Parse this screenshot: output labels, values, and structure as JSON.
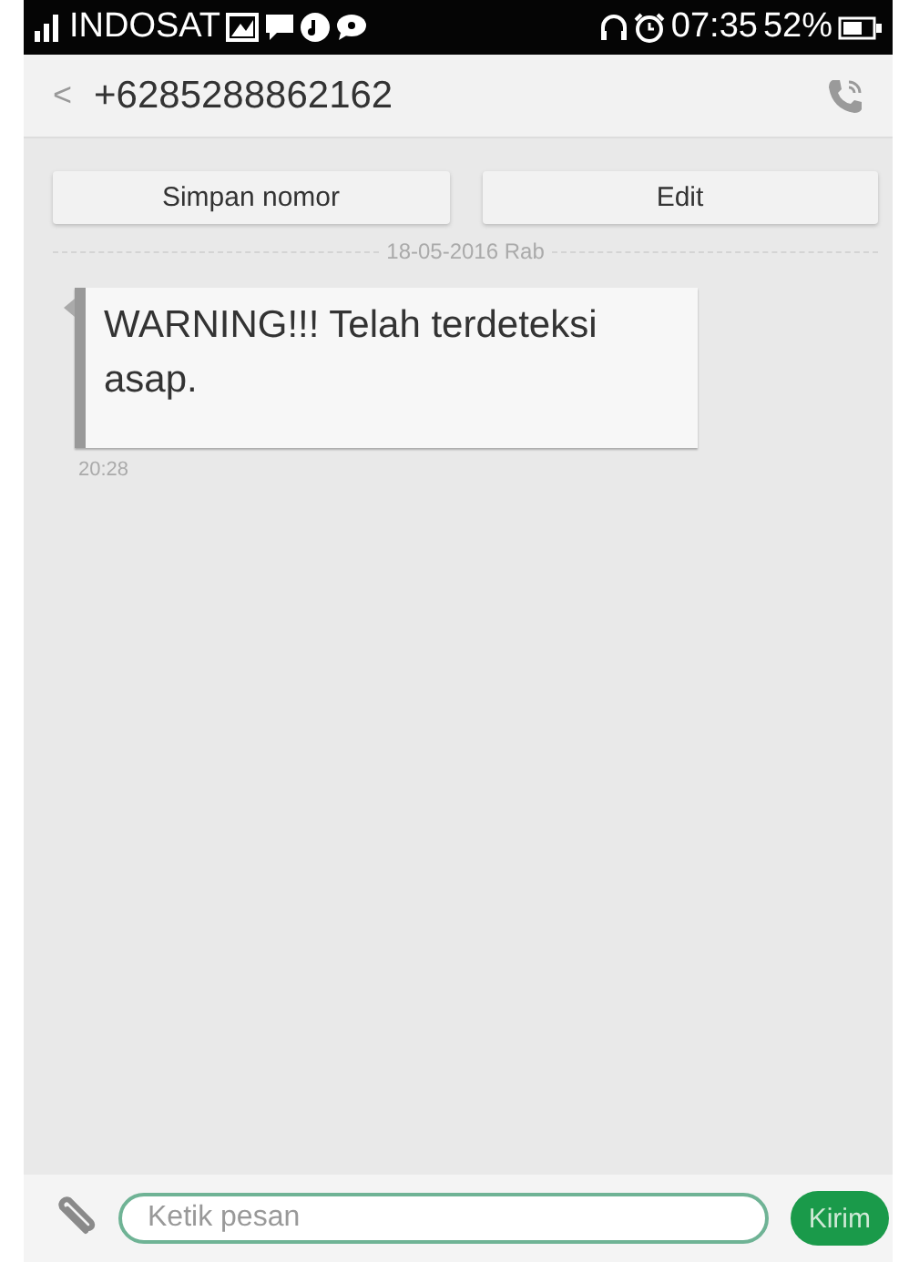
{
  "status_bar": {
    "carrier": "INDOSAT",
    "time": "07:35",
    "battery": "52%"
  },
  "header": {
    "back": "<",
    "title": "+6285288862162"
  },
  "actions": [
    "Simpan nomor",
    "Edit"
  ],
  "date_separator": "18-05-2016 Rab",
  "messages": [
    {
      "text": "WARNING!!! Telah terdeteksi asap.",
      "time": "20:28"
    }
  ],
  "composer": {
    "placeholder": "Ketik pesan",
    "send": "Kirim"
  }
}
